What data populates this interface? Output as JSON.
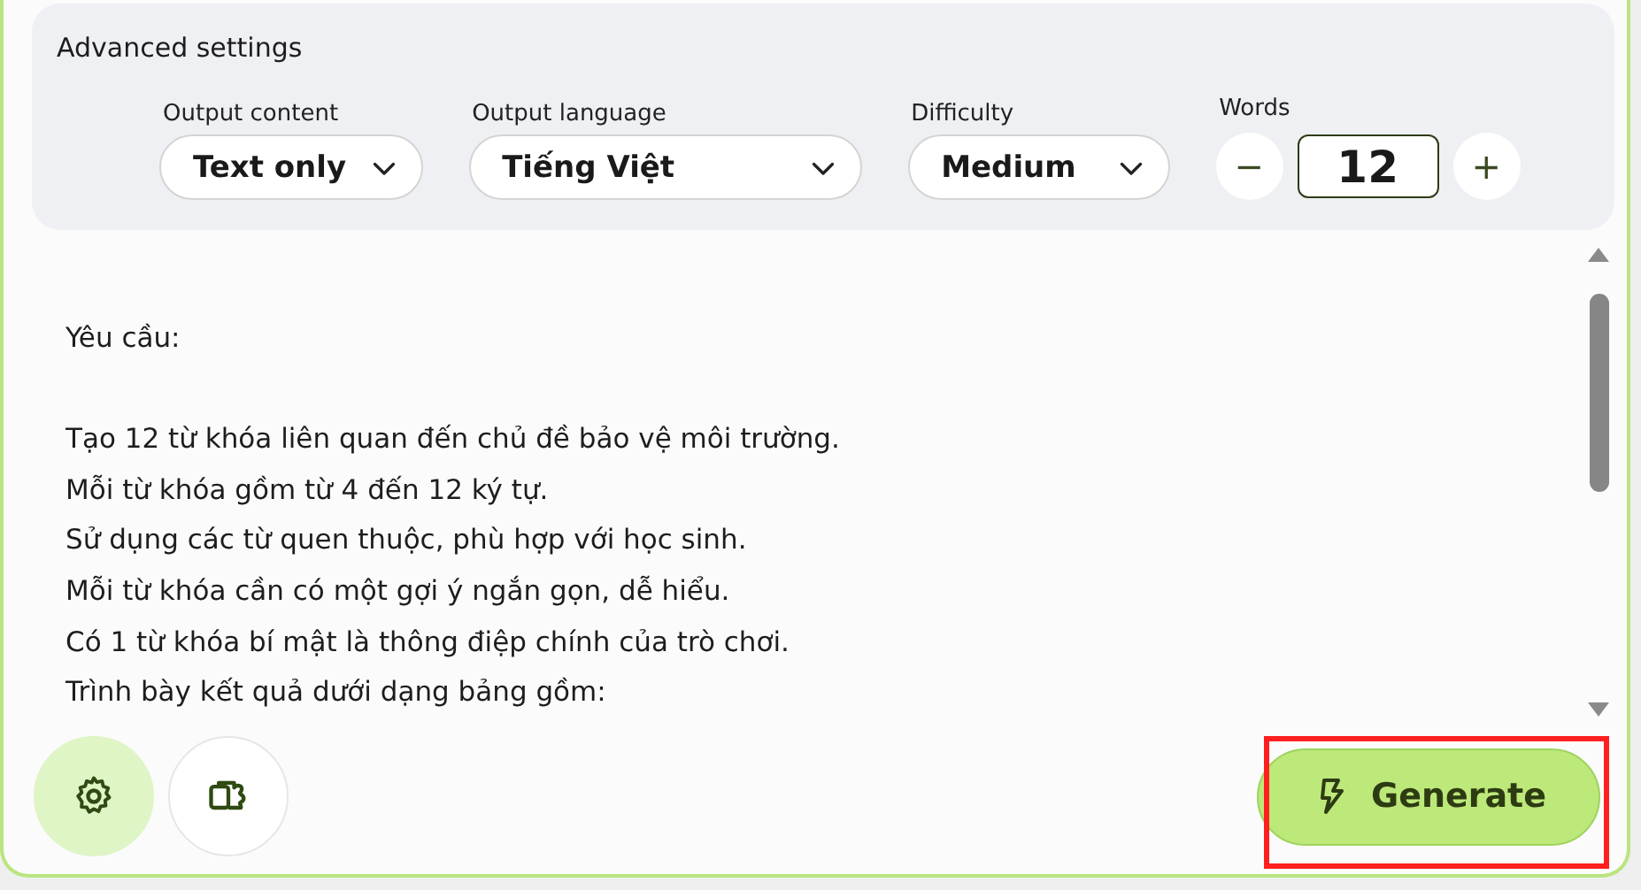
{
  "advanced_settings": {
    "title": "Advanced settings",
    "dropdowns": [
      {
        "label": "Output content",
        "value": "Text only"
      },
      {
        "label": "Output language",
        "value": "Tiếng Việt"
      },
      {
        "label": "Difficulty",
        "value": "Medium"
      }
    ],
    "stepper": {
      "label": "Words",
      "value": "12",
      "minus": "−",
      "plus": "+"
    }
  },
  "prompt_paragraphs": [
    [
      "Yêu cầu:"
    ],
    [
      "Tạo 12 từ khóa liên quan đến chủ đề bảo vệ môi trường.",
      "Mỗi từ khóa gồm từ 4 đến 12 ký tự.",
      "Sử dụng các từ quen thuộc, phù hợp với học sinh.",
      "Mỗi từ khóa cần có một gợi ý ngắn gọn, dễ hiểu.",
      "Có 1 từ khóa bí mật là thông điệp chính của trò chơi.",
      "Trình bày kết quả dưới dạng bảng gồm:"
    ]
  ],
  "toolbar": {
    "settings_selected": true,
    "generate": {
      "label": "Generate",
      "highlighted": true
    }
  }
}
